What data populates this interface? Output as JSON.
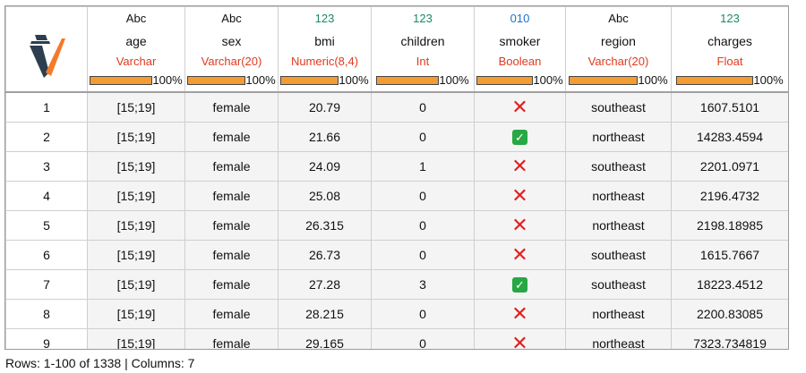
{
  "columns": [
    {
      "type_icon": "Abc",
      "name": "age",
      "dtype": "Varchar",
      "completeness": "100%",
      "icon_color": "#111111"
    },
    {
      "type_icon": "Abc",
      "name": "sex",
      "dtype": "Varchar(20)",
      "completeness": "100%",
      "icon_color": "#111111"
    },
    {
      "type_icon": "123",
      "name": "bmi",
      "dtype": "Numeric(8,4)",
      "completeness": "100%",
      "icon_color": "#1a8a6a"
    },
    {
      "type_icon": "123",
      "name": "children",
      "dtype": "Int",
      "completeness": "100%",
      "icon_color": "#1a8a6a"
    },
    {
      "type_icon": "010",
      "name": "smoker",
      "dtype": "Boolean",
      "completeness": "100%",
      "icon_color": "#1f6fd0"
    },
    {
      "type_icon": "Abc",
      "name": "region",
      "dtype": "Varchar(20)",
      "completeness": "100%",
      "icon_color": "#111111"
    },
    {
      "type_icon": "123",
      "name": "charges",
      "dtype": "Float",
      "completeness": "100%",
      "icon_color": "#1a8a6a"
    }
  ],
  "colors": {
    "dtype": "#e03a1e",
    "bar_fill": "#f39c34",
    "false_mark": "#e02020",
    "true_mark": "#27a844"
  },
  "rows": [
    {
      "index": "1",
      "age": "[15;19]",
      "sex": "female",
      "bmi": "20.79",
      "children": "0",
      "smoker": false,
      "region": "southeast",
      "charges": "1607.5101"
    },
    {
      "index": "2",
      "age": "[15;19]",
      "sex": "female",
      "bmi": "21.66",
      "children": "0",
      "smoker": true,
      "region": "northeast",
      "charges": "14283.4594"
    },
    {
      "index": "3",
      "age": "[15;19]",
      "sex": "female",
      "bmi": "24.09",
      "children": "1",
      "smoker": false,
      "region": "southeast",
      "charges": "2201.0971"
    },
    {
      "index": "4",
      "age": "[15;19]",
      "sex": "female",
      "bmi": "25.08",
      "children": "0",
      "smoker": false,
      "region": "northeast",
      "charges": "2196.4732"
    },
    {
      "index": "5",
      "age": "[15;19]",
      "sex": "female",
      "bmi": "26.315",
      "children": "0",
      "smoker": false,
      "region": "northeast",
      "charges": "2198.18985"
    },
    {
      "index": "6",
      "age": "[15;19]",
      "sex": "female",
      "bmi": "26.73",
      "children": "0",
      "smoker": false,
      "region": "southeast",
      "charges": "1615.7667"
    },
    {
      "index": "7",
      "age": "[15;19]",
      "sex": "female",
      "bmi": "27.28",
      "children": "3",
      "smoker": true,
      "region": "southeast",
      "charges": "18223.4512"
    },
    {
      "index": "8",
      "age": "[15;19]",
      "sex": "female",
      "bmi": "28.215",
      "children": "0",
      "smoker": false,
      "region": "northeast",
      "charges": "2200.83085"
    },
    {
      "index": "9",
      "age": "[15;19]",
      "sex": "female",
      "bmi": "29.165",
      "children": "0",
      "smoker": false,
      "region": "northeast",
      "charges": "7323.734819"
    }
  ],
  "status_text": "Rows: 1-100 of 1338 | Columns: 7"
}
